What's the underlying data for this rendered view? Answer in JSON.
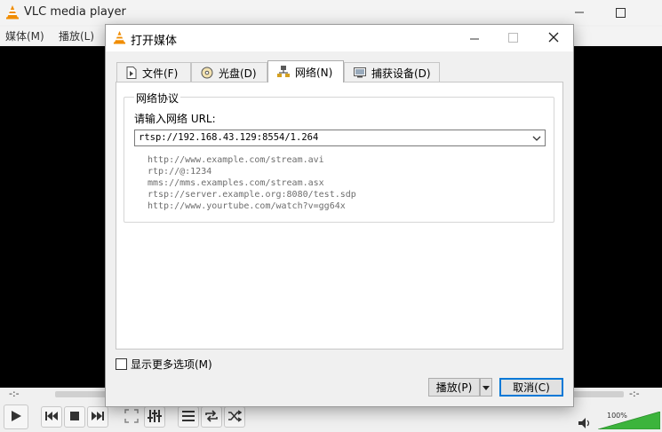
{
  "main_window": {
    "title": "VLC media player",
    "menu": [
      "媒体(M)",
      "播放(L)"
    ],
    "time_elapsed": "-:-",
    "time_total": "-:-",
    "volume_label": "100%"
  },
  "dialog": {
    "title": "打开媒体",
    "tabs": [
      {
        "label": "文件(F)",
        "icon": "file-icon"
      },
      {
        "label": "光盘(D)",
        "icon": "disc-icon"
      },
      {
        "label": "网络(N)",
        "icon": "network-icon",
        "active": true
      },
      {
        "label": "捕获设备(D)",
        "icon": "capture-device-icon"
      }
    ],
    "network": {
      "group_title": "网络协议",
      "url_label": "请输入网络 URL:",
      "url_value": "rtsp://192.168.43.129:8554/1.264",
      "examples": [
        "http://www.example.com/stream.avi",
        "rtp://@:1234",
        "mms://mms.examples.com/stream.asx",
        "rtsp://server.example.org:8080/test.sdp",
        "http://www.yourtube.com/watch?v=gg64x"
      ]
    },
    "show_more_options": "显示更多选项(M)",
    "show_more_checked": false,
    "play_button": "播放(P)",
    "cancel_button": "取消(C)"
  },
  "colors": {
    "accent": "#0078d7",
    "vlc_orange": "#f08c00",
    "video_bg": "#000000",
    "volume_green": "#3cb43c"
  }
}
